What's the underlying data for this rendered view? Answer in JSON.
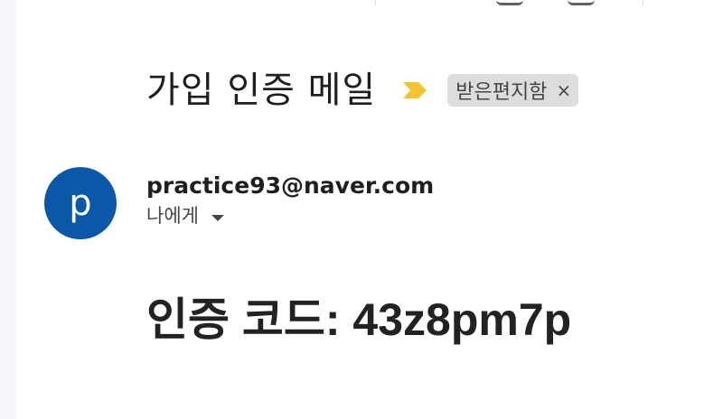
{
  "email": {
    "subject": "가입 인증 메일",
    "important_icon": "important-marker-icon",
    "label_chip": {
      "label": "받은편지함",
      "close": "×"
    },
    "sender": {
      "avatar_letter": "p",
      "email": "practice93@naver.com",
      "recipient_text": "나에게",
      "recipient_icon": "chevron-down-icon"
    },
    "body": {
      "content": "인증 코드: 43z8pm7p"
    }
  },
  "colors": {
    "avatar": "#0b57a8",
    "important": "#f4c430",
    "chip_bg": "#dddddd",
    "left_panel": "#f6f8fc"
  }
}
